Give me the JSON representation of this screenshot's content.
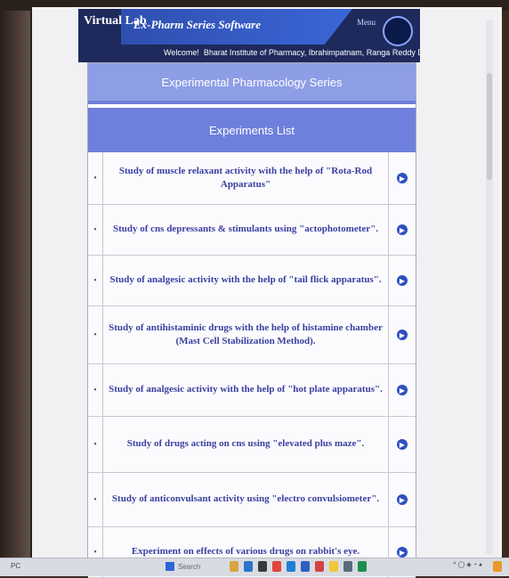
{
  "header": {
    "lab_label": "Virtual Lab",
    "app_title": "Ex-Pharm Series Software",
    "menu_label": "Menu",
    "welcome_label": "Welcome!",
    "institute": "Bharat Institute of Pharmacy, Ibrahimpatnam, Ranga Reddy District, Telangana"
  },
  "series_title": "Experimental Pharmacology Series",
  "list_title": "Experiments List",
  "experiments": [
    {
      "text": "Study of muscle relaxant activity with the help of \"Rota-Rod Apparatus\""
    },
    {
      "text": "Study of cns depressants & stimulants using \"actophotometer\"."
    },
    {
      "text": "Study of analgesic activity with the help of \"tail flick apparatus\"."
    },
    {
      "text": "Study of antihistaminic drugs with the help of histamine chamber (Mast Cell Stabilization Method)."
    },
    {
      "text": "Study of analgesic activity with the help of \"hot plate apparatus\"."
    },
    {
      "text": "Study of drugs acting on cns using \"elevated plus maze\"."
    },
    {
      "text": "Study of anticonvulsant activity using \"electro convulsiometer\"."
    },
    {
      "text": "Experiment on effects of various drugs on rabbit's eye."
    }
  ],
  "taskbar": {
    "left_text": "PC",
    "search_text": "Search"
  },
  "colors": {
    "header_dark": "#1e2a5c",
    "accent_blue": "#3b66d6",
    "bar_light": "#8e9ee6",
    "bar_mid": "#6e80dc",
    "link_text": "#3a3fa0"
  }
}
